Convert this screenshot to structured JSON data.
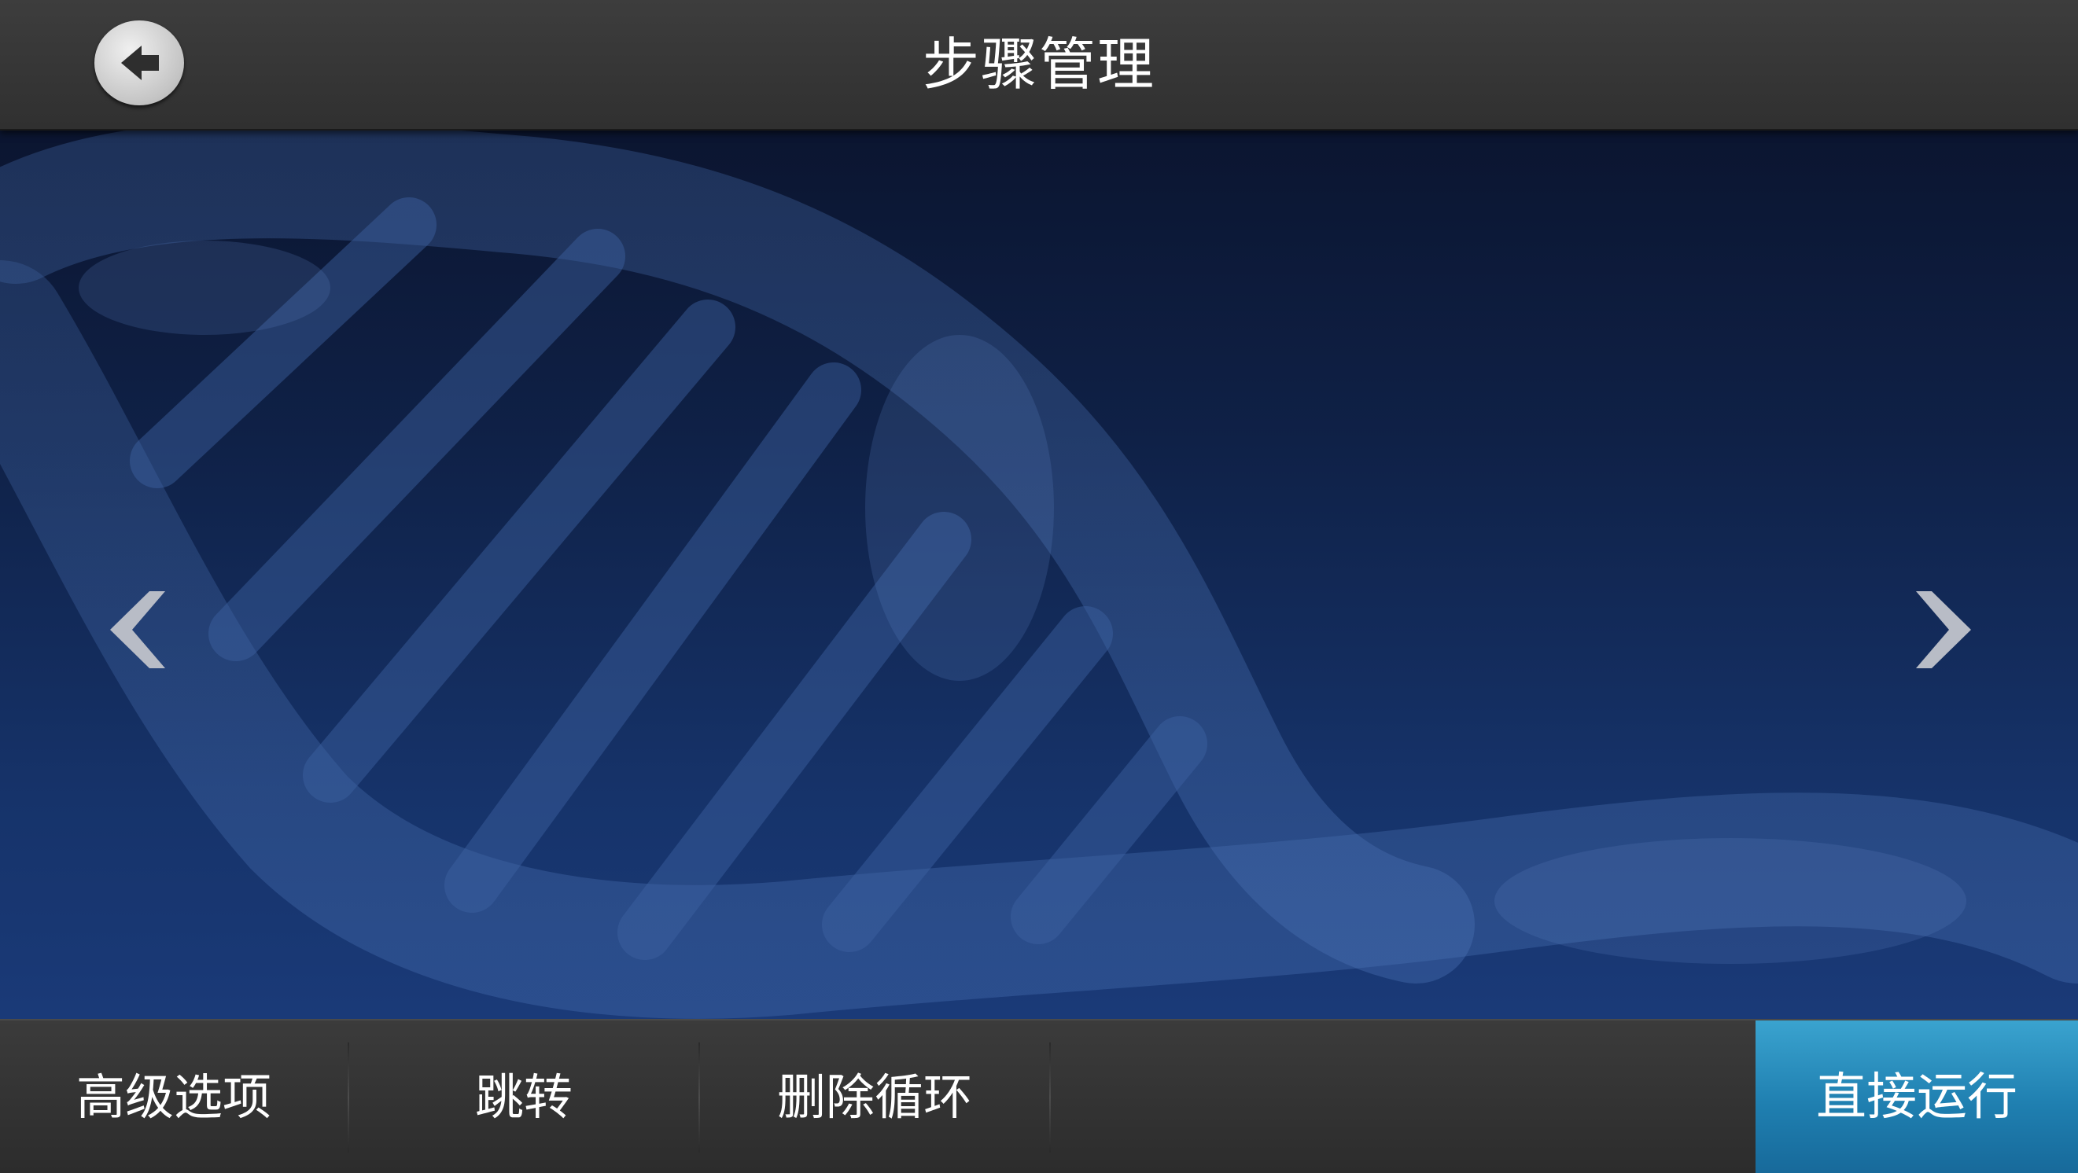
{
  "header": {
    "title": "步骤管理",
    "back_icon": "back-arrow-icon"
  },
  "main": {
    "background": "dna-helix-image",
    "prev_icon": "chevron-left-icon",
    "next_icon": "chevron-right-icon"
  },
  "toolbar": {
    "advanced_options_label": "高级选项",
    "jump_label": "跳转",
    "delete_loop_label": "删除循环",
    "run_directly_label": "直接运行"
  },
  "colors": {
    "header_bg": "#353535",
    "toolbar_bg": "#333333",
    "run_button": "#2a8fc0",
    "background_top": "#0b1530",
    "background_bottom": "#1a3a78"
  }
}
